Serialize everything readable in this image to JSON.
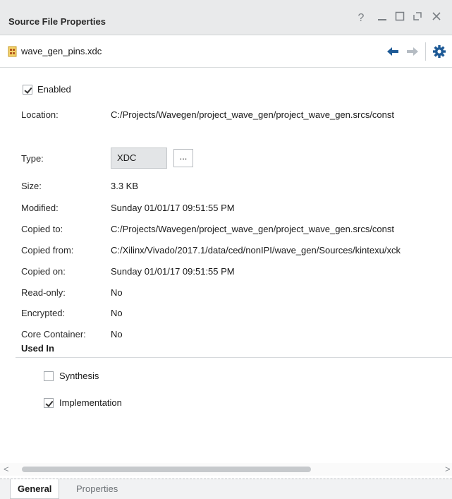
{
  "window": {
    "title": "Source File Properties",
    "buttons": {
      "help": "?",
      "minimize": "—",
      "maximize": "☐",
      "float": "⧉",
      "close": "✕"
    }
  },
  "file": {
    "name": "wave_gen_pins.xdc",
    "icon": "xdc-file-icon"
  },
  "enabled": {
    "label": "Enabled",
    "checked": true
  },
  "properties": {
    "location": {
      "label": "Location:",
      "value": "C:/Projects/Wavegen/project_wave_gen/project_wave_gen.srcs/const"
    },
    "type": {
      "label": "Type:",
      "value": "XDC",
      "browse": "..."
    },
    "size": {
      "label": "Size:",
      "value": "3.3 KB"
    },
    "modified": {
      "label": "Modified:",
      "value": "Sunday 01/01/17 09:51:55 PM"
    },
    "copied_to": {
      "label": "Copied to:",
      "value": "C:/Projects/Wavegen/project_wave_gen/project_wave_gen.srcs/const"
    },
    "copied_from": {
      "label": "Copied from:",
      "value": "C:/Xilinx/Vivado/2017.1/data/ced/nonIPI/wave_gen/Sources/kintexu/xck"
    },
    "copied_on": {
      "label": "Copied on:",
      "value": "Sunday 01/01/17 09:51:55 PM"
    },
    "read_only": {
      "label": "Read-only:",
      "value": "No"
    },
    "encrypted": {
      "label": "Encrypted:",
      "value": "No"
    },
    "core_container": {
      "label": "Core Container:",
      "value": "No"
    }
  },
  "used_in": {
    "title": "Used In",
    "synthesis": {
      "label": "Synthesis",
      "checked": false
    },
    "implementation": {
      "label": "Implementation",
      "checked": true
    }
  },
  "scrollbar": {
    "left": "<",
    "right": ">"
  },
  "tabs": {
    "general": "General",
    "properties": "Properties",
    "active": "General"
  },
  "colors": {
    "toolbar_blue": "#1e5a96",
    "gear": "#1e5a96",
    "disabled_arrow": "#b5bcc3"
  }
}
